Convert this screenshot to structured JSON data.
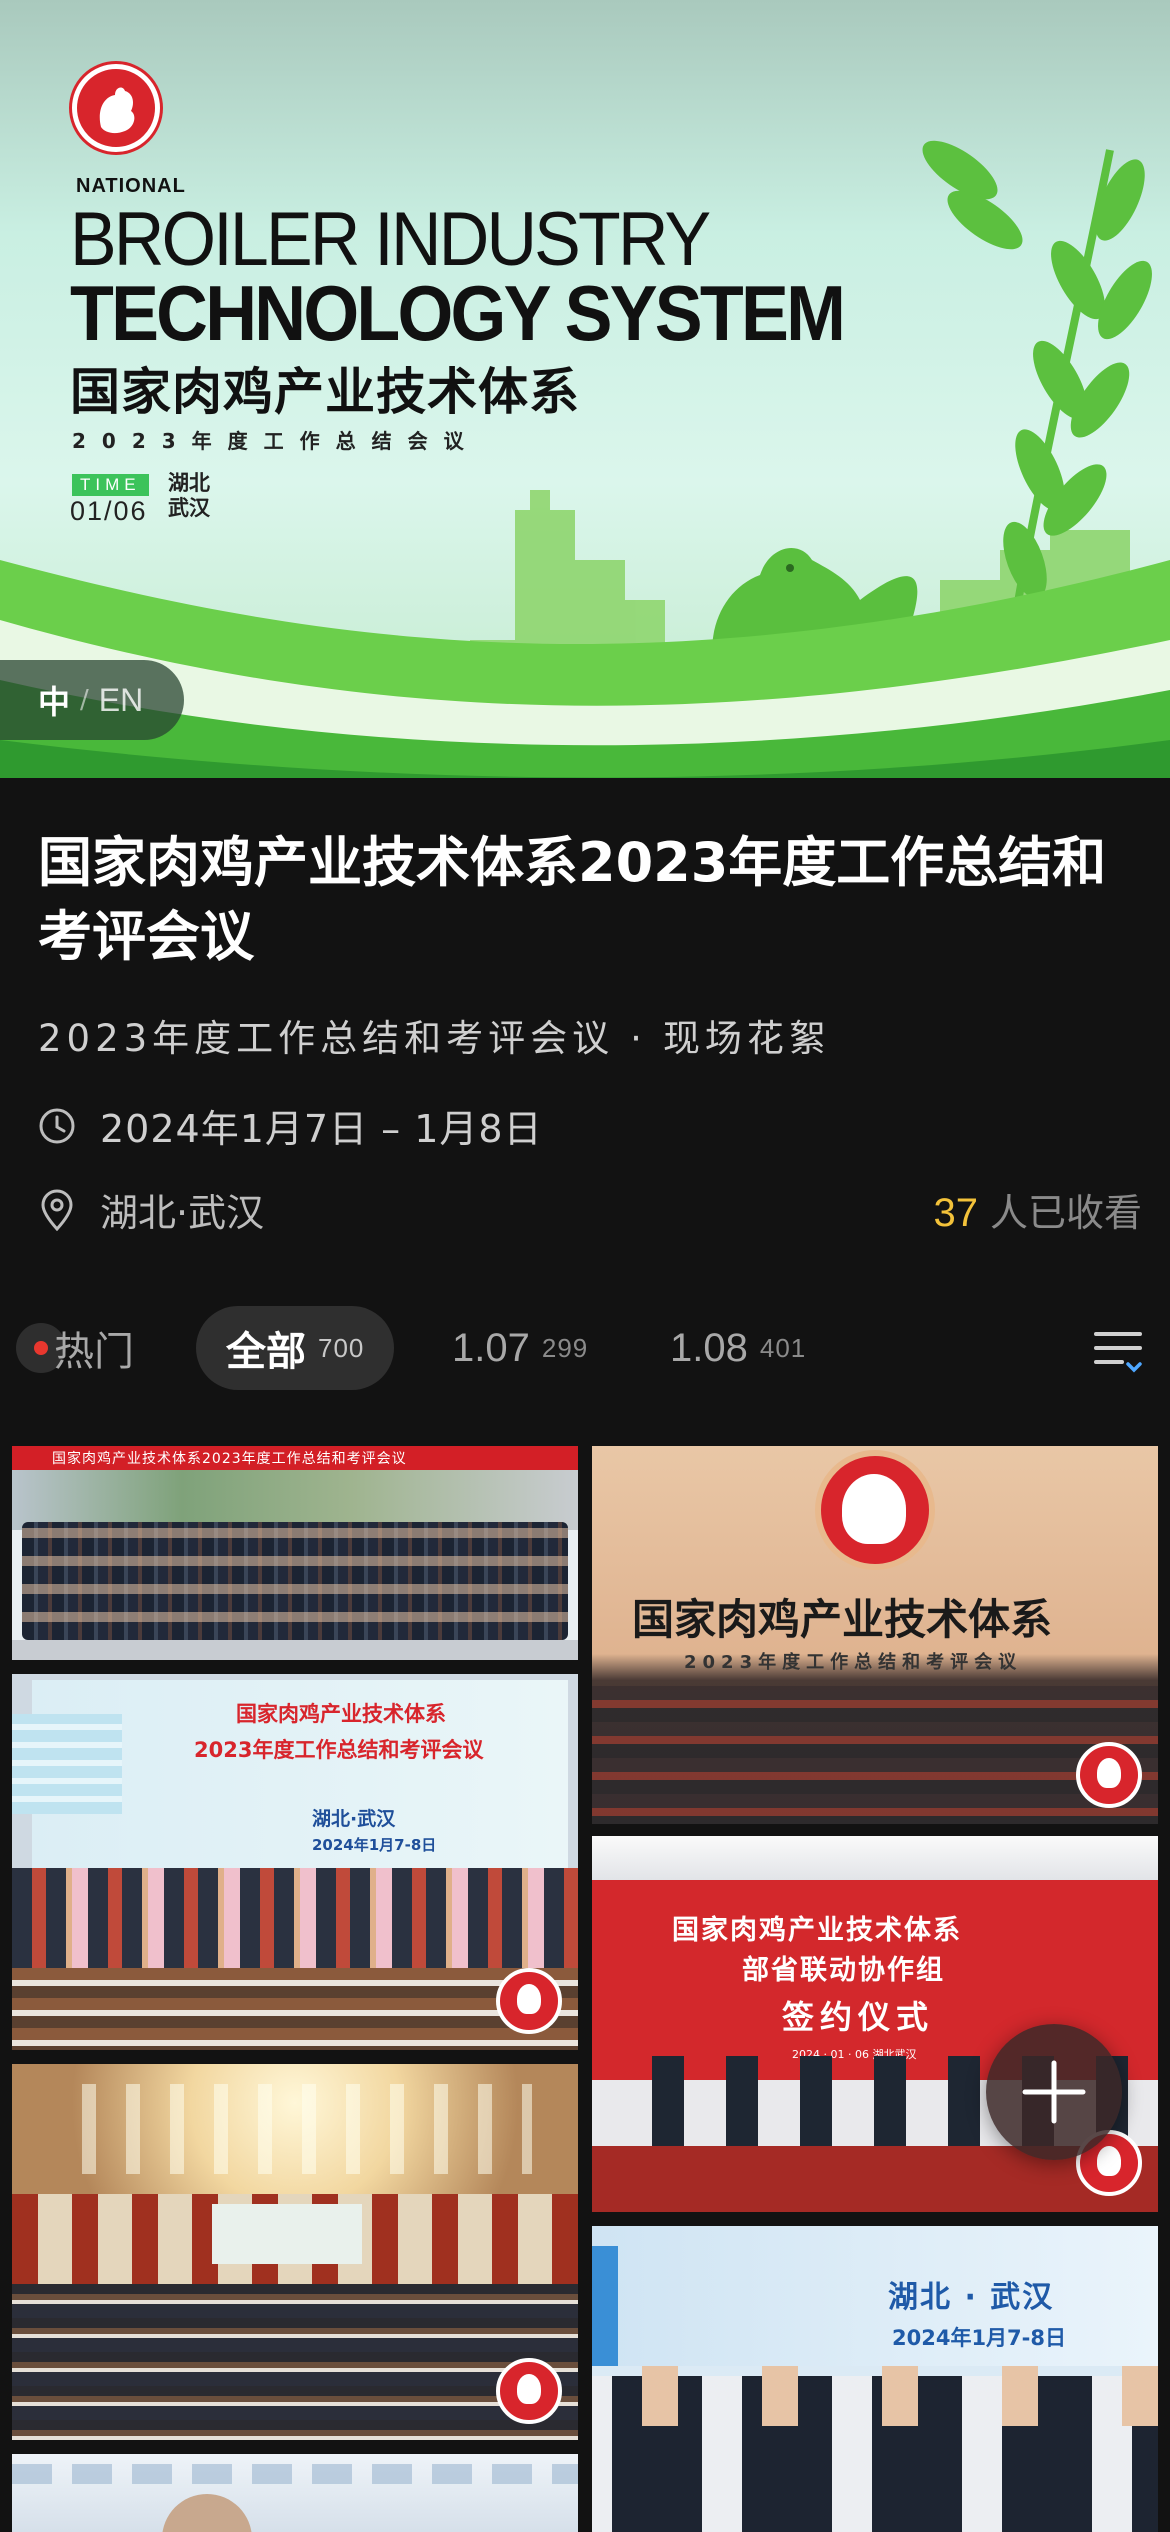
{
  "banner": {
    "national": "NATIONAL",
    "line1": "BROILER INDUSTRY",
    "line2": "TECHNOLOGY SYSTEM",
    "cn_title": "国家肉鸡产业技术体系",
    "cn_sub": "2023年度工作总结会议",
    "time_tag": "TIME",
    "date": "01/06",
    "city": "湖北 武汉"
  },
  "language": {
    "zh": "中",
    "separator": "/",
    "en": "EN"
  },
  "event": {
    "title": "国家肉鸡产业技术体系2023年度工作总结和考评会议",
    "subtitle": "2023年度工作总结和考评会议",
    "subtitle_suffix": "现场花絮",
    "subtitle_separator": "·",
    "date_range": "2024年1月7日 – 1月8日",
    "location": "湖北·武汉",
    "favorites_count": "37",
    "favorites_label": "人已收看"
  },
  "tabs": {
    "hot": {
      "label": "热门"
    },
    "all": {
      "label": "全部",
      "count": "700"
    },
    "day1": {
      "label": "1.07",
      "count": "299"
    },
    "day2": {
      "label": "1.08",
      "count": "401"
    }
  },
  "photos": {
    "p1": {
      "banner_text": "国家肉鸡产业技术体系2023年度工作总结和考评会议"
    },
    "p2": {
      "title": "国家肉鸡产业技术体系",
      "sub": "2023年度工作总结和考评会议"
    },
    "p3": {
      "line1": "国家肉鸡产业技术体系",
      "line2": "2023年度工作总结和考评会议",
      "place": "湖北·武汉",
      "date": "2024年1月7-8日"
    },
    "p4": {
      "line1": "国家肉鸡产业技术体系",
      "line2": "部省联动协作组",
      "line3": "签约仪式",
      "small": "2024 · 01 · 06    湖北武汉"
    },
    "p6": {
      "place": "湖北 · 武汉",
      "date": "2024年1月7-8日"
    }
  },
  "colors": {
    "accent_yellow": "#f3c23a",
    "brand_red": "#d8252c",
    "brand_green": "#3cc35b",
    "background": "#121212"
  },
  "icons": [
    "clock-icon",
    "location-pin-icon",
    "filter-icon",
    "plus-icon",
    "rooster-logo-icon"
  ]
}
